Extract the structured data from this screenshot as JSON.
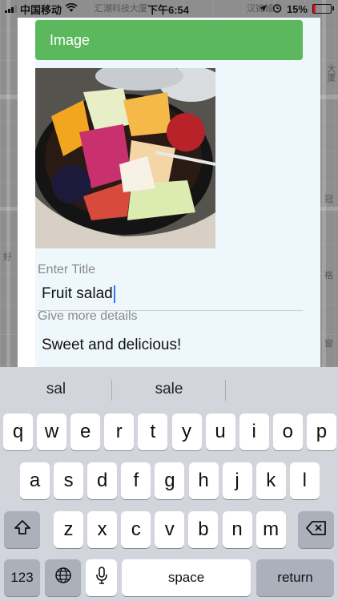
{
  "status_bar": {
    "carrier": "中国移动",
    "time": "下午6:54",
    "battery": "15%",
    "battery_level": 0.15
  },
  "map": {
    "labels": [
      "汇潮科技大厦",
      "汉锦城",
      "大厦",
      "冠",
      "好",
      "格",
      "窗"
    ]
  },
  "form": {
    "image_button": "Image",
    "title_label": "Enter Title",
    "title_value": "Fruit salad",
    "details_label": "Give more details",
    "details_value": "Sweet and delicious!"
  },
  "keyboard": {
    "suggestions": [
      "sal",
      "sale",
      ""
    ],
    "row1": [
      "q",
      "w",
      "e",
      "r",
      "t",
      "y",
      "u",
      "i",
      "o",
      "p"
    ],
    "row2": [
      "a",
      "s",
      "d",
      "f",
      "g",
      "h",
      "j",
      "k",
      "l"
    ],
    "row3": [
      "z",
      "x",
      "c",
      "v",
      "b",
      "n",
      "m"
    ],
    "numbers_key": "123",
    "space_key": "space",
    "return_key": "return",
    "icons": {
      "shift": "shift-icon",
      "delete": "delete-icon",
      "globe": "globe-icon",
      "mic": "microphone-icon"
    }
  },
  "colors": {
    "button_green": "#5cb85c",
    "caret_blue": "#3478f6",
    "keyboard_bg": "#d2d5db"
  }
}
